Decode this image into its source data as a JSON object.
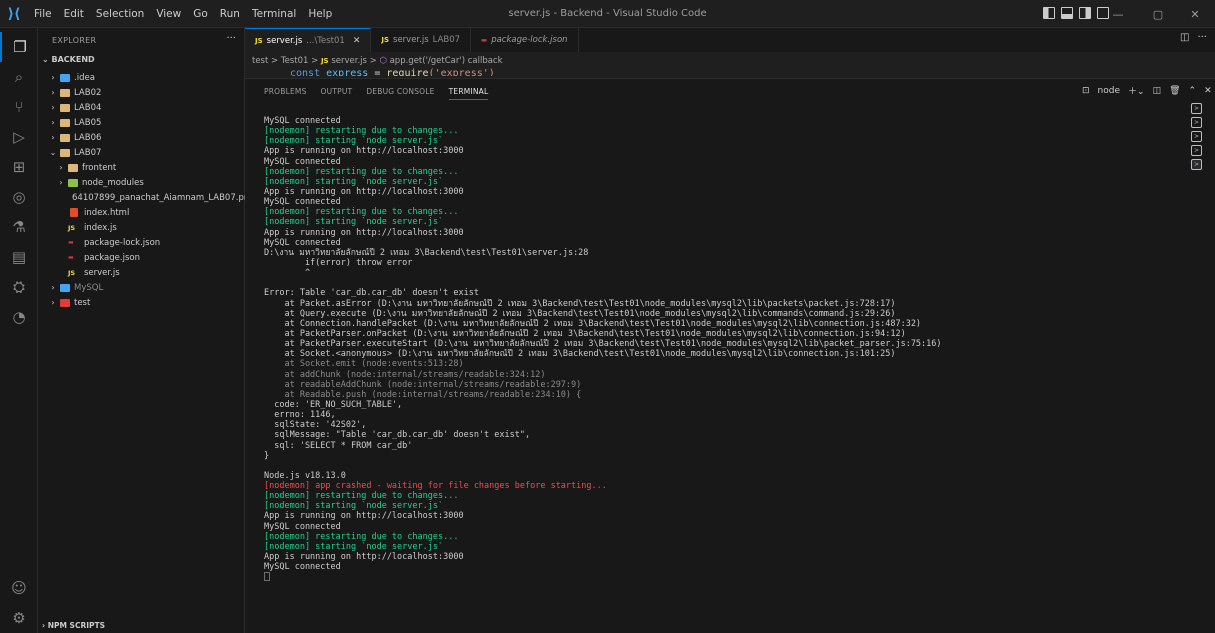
{
  "window": {
    "title": "server.js - Backend - Visual Studio Code"
  },
  "menu": [
    "File",
    "Edit",
    "Selection",
    "View",
    "Go",
    "Run",
    "Terminal",
    "Help"
  ],
  "sidebar": {
    "title": "EXPLORER",
    "root": "BACKEND",
    "items": [
      {
        "label": ".idea",
        "type": "folder"
      },
      {
        "label": "LAB02",
        "type": "folder"
      },
      {
        "label": "LAB04",
        "type": "folder"
      },
      {
        "label": "LAB05",
        "type": "folder"
      },
      {
        "label": "LAB06",
        "type": "folder"
      },
      {
        "label": "LAB07",
        "type": "folder"
      },
      {
        "label": "frontent",
        "type": "folder"
      },
      {
        "label": "node_modules",
        "type": "folder"
      },
      {
        "label": "64107899_panachat_Aiamnam_LAB07.png",
        "type": "png"
      },
      {
        "label": "index.html",
        "type": "html"
      },
      {
        "label": "index.js",
        "type": "js"
      },
      {
        "label": "package-lock.json",
        "type": "json"
      },
      {
        "label": "package.json",
        "type": "json"
      },
      {
        "label": "server.js",
        "type": "js"
      },
      {
        "label": "MySQL",
        "type": "folder"
      },
      {
        "label": "test",
        "type": "folder"
      }
    ],
    "npm_scripts": "NPM SCRIPTS"
  },
  "tabs": [
    {
      "label": "server.js",
      "path": "...\\Test01",
      "active": true
    },
    {
      "label": "server.js",
      "path": "LAB07",
      "active": false
    },
    {
      "label": "package-lock.json",
      "path": "",
      "active": false
    }
  ],
  "breadcrumb": {
    "parts": [
      "test",
      "Test01",
      "server.js",
      "app.get('/getCar') callback"
    ],
    "sep": ">"
  },
  "code_peek": {
    "kw": "const",
    "id": "express",
    "eq": "=",
    "fn": "require",
    "arg": "('express')"
  },
  "panel": {
    "tabs": [
      "PROBLEMS",
      "OUTPUT",
      "DEBUG CONSOLE",
      "TERMINAL"
    ],
    "terminal_name": "node"
  },
  "terminal": [
    {
      "t": "MySQL connected",
      "c": "default"
    },
    {
      "t": "[nodemon] restarting due to changes...",
      "c": "green"
    },
    {
      "t": "[nodemon] starting `node server.js`",
      "c": "green"
    },
    {
      "t": "App is running on http://localhost:3000",
      "c": "default"
    },
    {
      "t": "MySQL connected",
      "c": "default"
    },
    {
      "t": "[nodemon] restarting due to changes...",
      "c": "green"
    },
    {
      "t": "[nodemon] starting `node server.js`",
      "c": "green"
    },
    {
      "t": "App is running on http://localhost:3000",
      "c": "default"
    },
    {
      "t": "MySQL connected",
      "c": "default"
    },
    {
      "t": "[nodemon] restarting due to changes...",
      "c": "green"
    },
    {
      "t": "[nodemon] starting `node server.js`",
      "c": "green"
    },
    {
      "t": "App is running on http://localhost:3000",
      "c": "default"
    },
    {
      "t": "MySQL connected",
      "c": "default"
    },
    {
      "t": "D:\\งาน มหาวิทยาลัยลักษณ์ปี 2 เทอม 3\\Backend\\test\\Test01\\server.js:28",
      "c": "default"
    },
    {
      "t": "        if(error) throw error",
      "c": "default"
    },
    {
      "t": "        ^",
      "c": "default"
    },
    {
      "t": "",
      "c": "default"
    },
    {
      "t": "Error: Table 'car_db.car_db' doesn't exist",
      "c": "default"
    },
    {
      "t": "    at Packet.asError (D:\\งาน มหาวิทยาลัยลักษณ์ปี 2 เทอม 3\\Backend\\test\\Test01\\node_modules\\mysql2\\lib\\packets\\packet.js:728:17)",
      "c": "default"
    },
    {
      "t": "    at Query.execute (D:\\งาน มหาวิทยาลัยลักษณ์ปี 2 เทอม 3\\Backend\\test\\Test01\\node_modules\\mysql2\\lib\\commands\\command.js:29:26)",
      "c": "default"
    },
    {
      "t": "    at Connection.handlePacket (D:\\งาน มหาวิทยาลัยลักษณ์ปี 2 เทอม 3\\Backend\\test\\Test01\\node_modules\\mysql2\\lib\\connection.js:487:32)",
      "c": "default"
    },
    {
      "t": "    at PacketParser.onPacket (D:\\งาน มหาวิทยาลัยลักษณ์ปี 2 เทอม 3\\Backend\\test\\Test01\\node_modules\\mysql2\\lib\\connection.js:94:12)",
      "c": "default"
    },
    {
      "t": "    at PacketParser.executeStart (D:\\งาน มหาวิทยาลัยลักษณ์ปี 2 เทอม 3\\Backend\\test\\Test01\\node_modules\\mysql2\\lib\\packet_parser.js:75:16)",
      "c": "default"
    },
    {
      "t": "    at Socket.<anonymous> (D:\\งาน มหาวิทยาลัยลักษณ์ปี 2 เทอม 3\\Backend\\test\\Test01\\node_modules\\mysql2\\lib\\connection.js:101:25)",
      "c": "default"
    },
    {
      "t": "    at Socket.emit (node:events:513:28)",
      "c": "gray"
    },
    {
      "t": "    at addChunk (node:internal/streams/readable:324:12)",
      "c": "gray"
    },
    {
      "t": "    at readableAddChunk (node:internal/streams/readable:297:9)",
      "c": "gray"
    },
    {
      "t": "    at Readable.push (node:internal/streams/readable:234:10) {",
      "c": "gray"
    },
    {
      "t": "  code: 'ER_NO_SUCH_TABLE',",
      "c": "default"
    },
    {
      "t": "  errno: 1146,",
      "c": "default"
    },
    {
      "t": "  sqlState: '42S02',",
      "c": "default"
    },
    {
      "t": "  sqlMessage: \"Table 'car_db.car_db' doesn't exist\",",
      "c": "default"
    },
    {
      "t": "  sql: 'SELECT * FROM car_db'",
      "c": "default"
    },
    {
      "t": "}",
      "c": "default"
    },
    {
      "t": "",
      "c": "default"
    },
    {
      "t": "Node.js v18.13.0",
      "c": "default"
    },
    {
      "t": "[nodemon] app crashed - waiting for file changes before starting...",
      "c": "red"
    },
    {
      "t": "[nodemon] restarting due to changes...",
      "c": "green"
    },
    {
      "t": "[nodemon] starting `node server.js`",
      "c": "green"
    },
    {
      "t": "App is running on http://localhost:3000",
      "c": "default"
    },
    {
      "t": "MySQL connected",
      "c": "default"
    },
    {
      "t": "[nodemon] restarting due to changes...",
      "c": "green"
    },
    {
      "t": "[nodemon] starting `node server.js`",
      "c": "green"
    },
    {
      "t": "App is running on http://localhost:3000",
      "c": "default"
    },
    {
      "t": "MySQL connected",
      "c": "default"
    }
  ],
  "colors": {
    "accent": "#0078d4",
    "term_green": "#23d18b",
    "term_red": "#f14c4c",
    "js_yellow": "#f1dd35"
  }
}
